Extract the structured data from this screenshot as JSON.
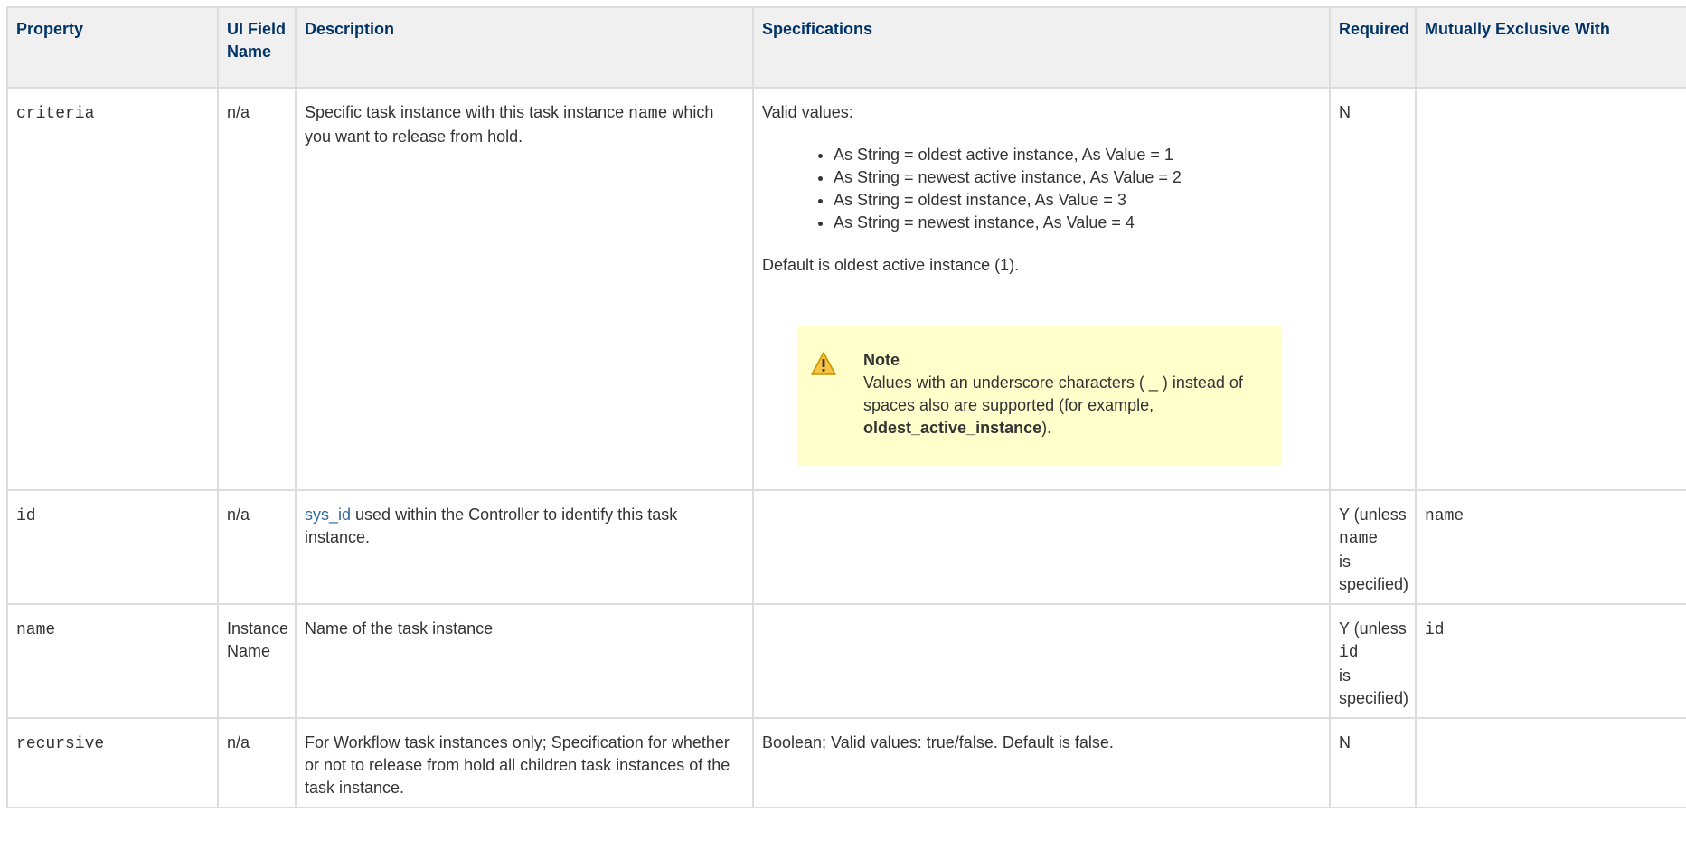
{
  "headers": {
    "property": "Property",
    "ui_field_name": "UI Field Name",
    "description": "Description",
    "specifications": "Specifications",
    "required": "Required",
    "mutually_exclusive": "Mutually Exclusive With"
  },
  "rows": {
    "criteria": {
      "property": "criteria",
      "ui_field": "n/a",
      "desc_pre": "Specific task instance with this task instance ",
      "desc_code": "name",
      "desc_post": " which you want to release from hold.",
      "spec_intro": "Valid values:",
      "spec_items": [
        "As String = oldest active instance, As Value = 1",
        "As String = newest active instance, As Value = 2",
        "As String = oldest instance, As Value = 3",
        "As String = newest instance, As Value = 4"
      ],
      "spec_default": "Default is oldest active instance (1).",
      "note_title": "Note",
      "note_text_pre": "Values with an underscore characters ( _ ) instead of spaces also are supported (for example, ",
      "note_text_bold": "oldest_active_instance",
      "note_text_post": ").",
      "required": "N",
      "exclusive": ""
    },
    "id": {
      "property": "id",
      "ui_field": "n/a",
      "desc_link": "sys_id",
      "desc_post": " used within the Controller to identify this task instance.",
      "required_pre": "Y (unless",
      "required_code": "name",
      "required_post": "is specified)",
      "exclusive": "name"
    },
    "name": {
      "property": "name",
      "ui_field": "Instance Name",
      "description": "Name of the task instance",
      "required_pre": "Y (unless",
      "required_code": "id",
      "required_post": "is specified)",
      "exclusive": "id"
    },
    "recursive": {
      "property": "recursive",
      "ui_field": "n/a",
      "description": "For Workflow task instances only; Specification for whether or not to release from hold all children task instances of the task instance.",
      "specifications": "Boolean; Valid values: true/false. Default is false.",
      "required": "N",
      "exclusive": ""
    }
  },
  "icons": {
    "note": "warning-icon"
  },
  "colors": {
    "header_text": "#003366",
    "header_bg": "#f0f0f0",
    "note_bg": "#ffffcc",
    "link": "#326ca6",
    "border": "#dddddd"
  }
}
